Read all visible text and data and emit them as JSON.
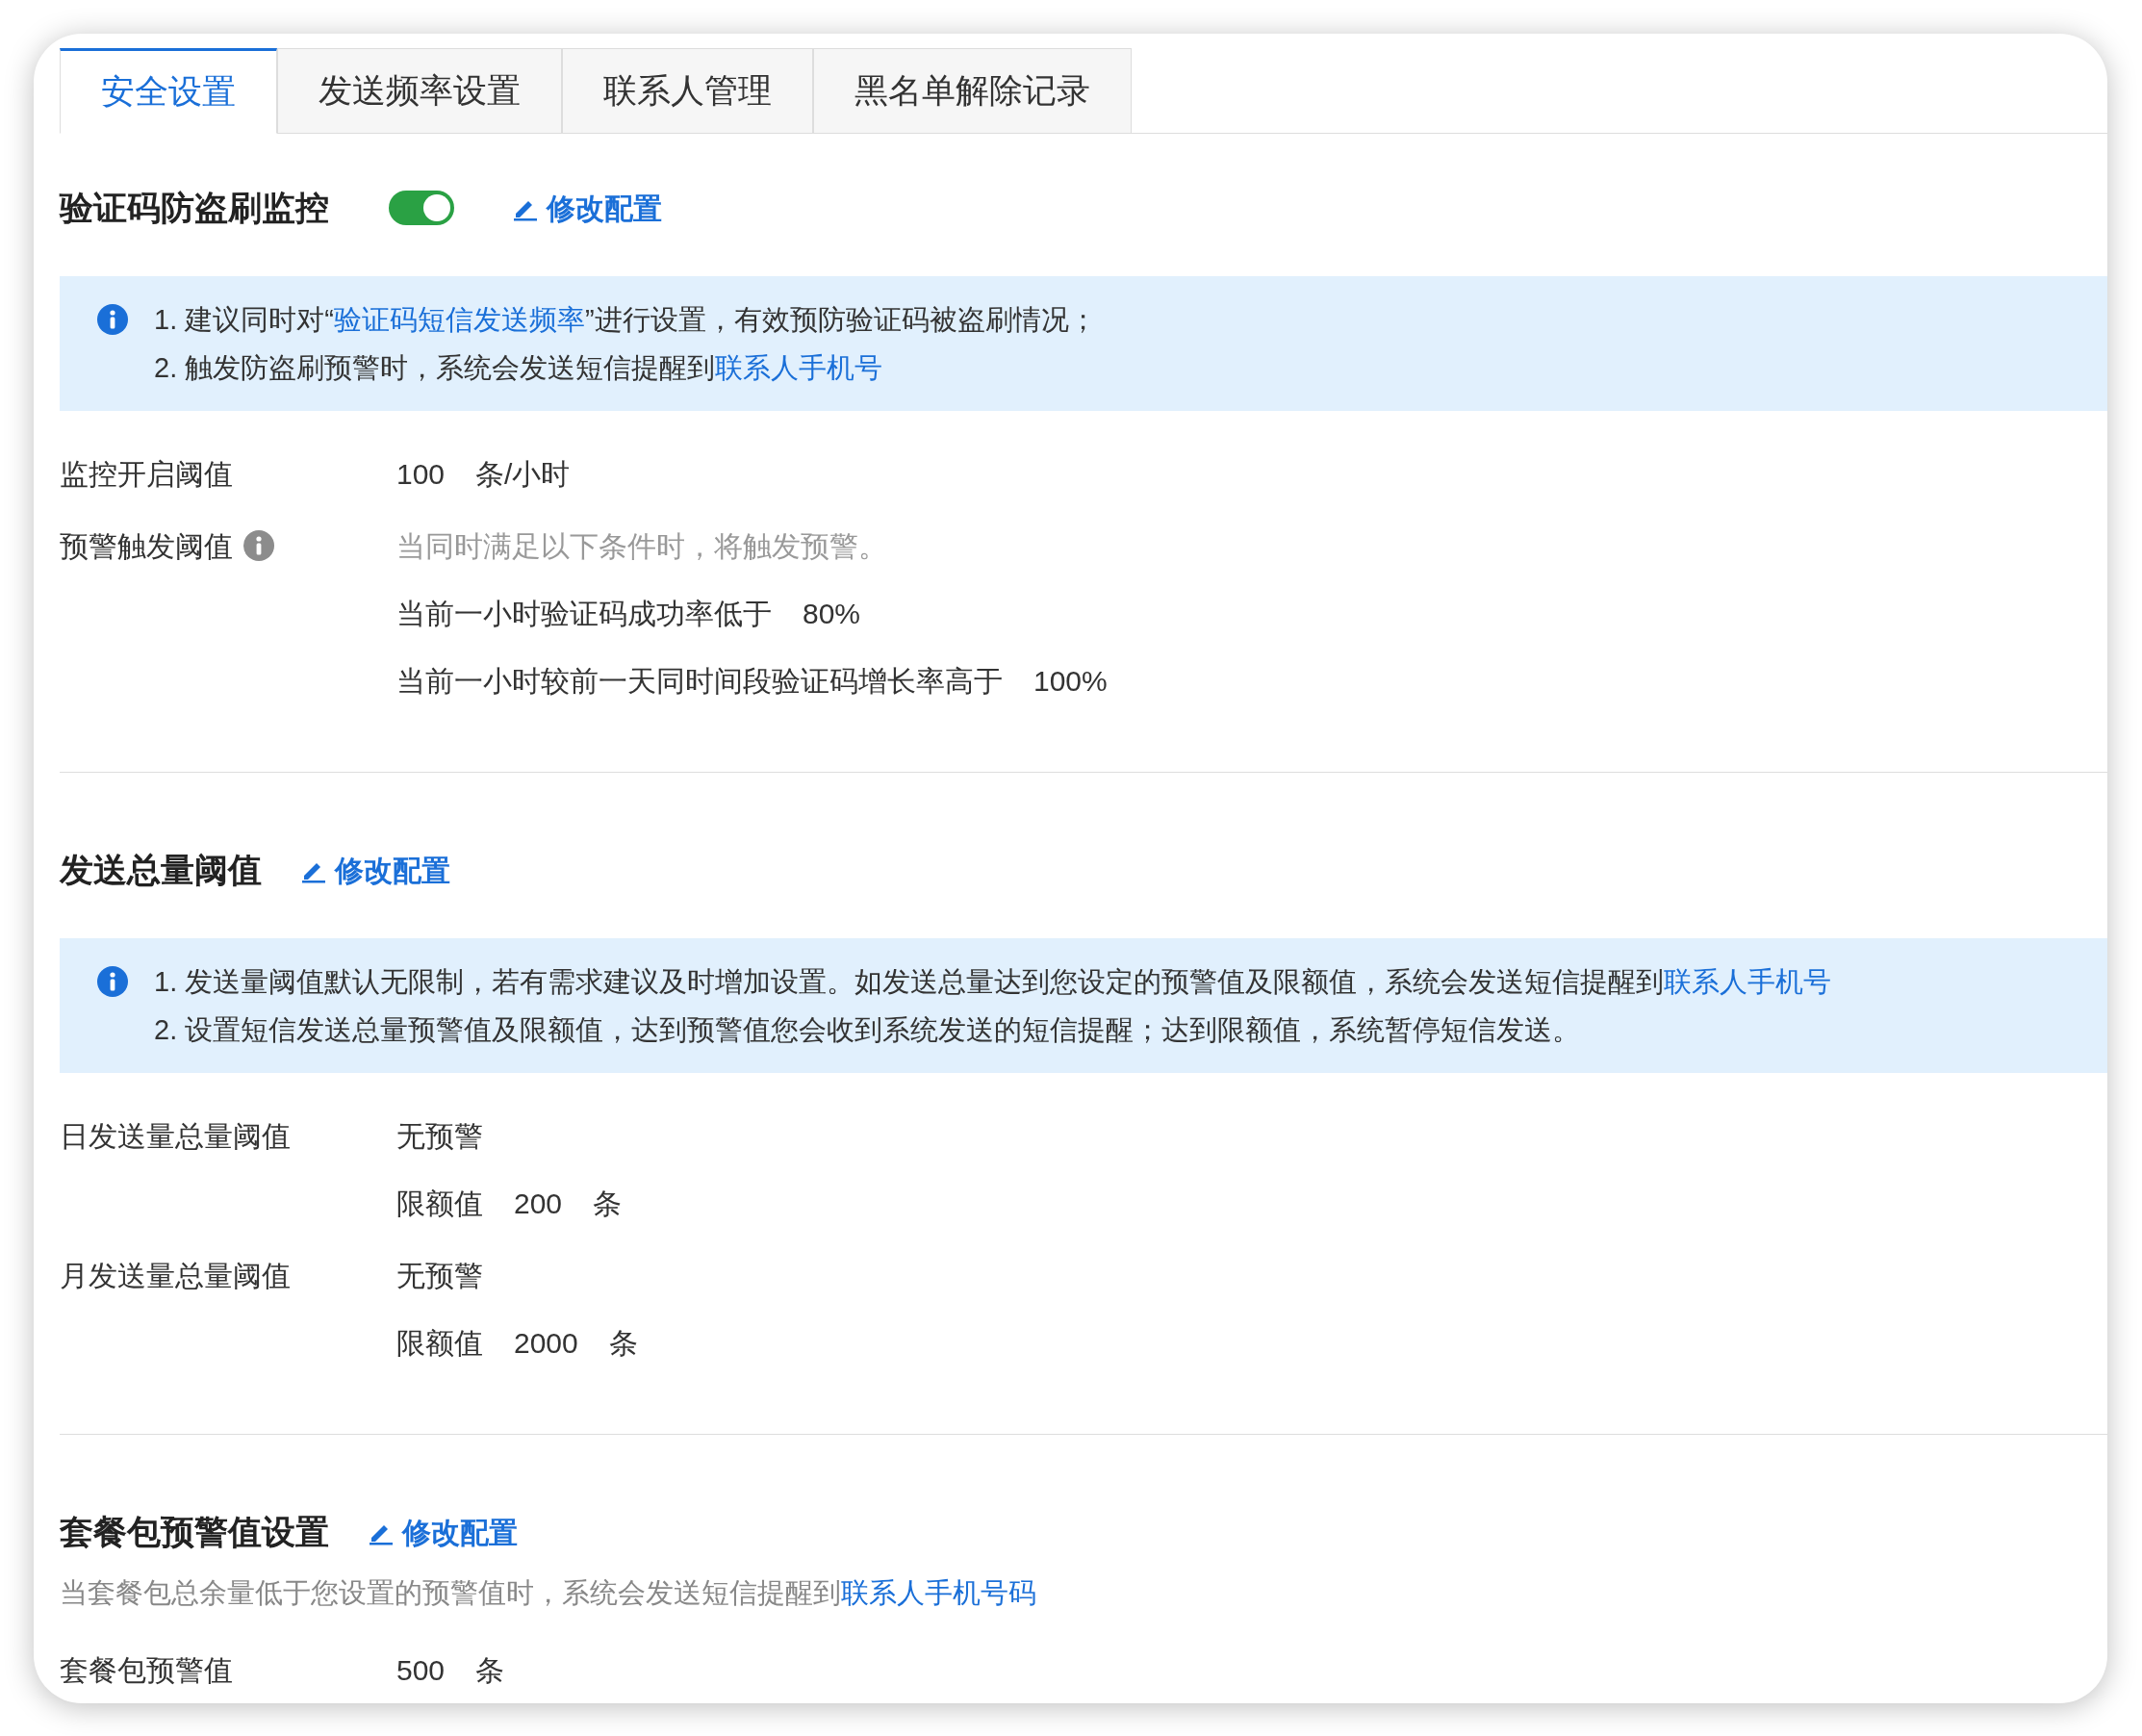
{
  "tabs": [
    {
      "label": "安全设置",
      "selected": true
    },
    {
      "label": "发送频率设置",
      "selected": false
    },
    {
      "label": "联系人管理",
      "selected": false
    },
    {
      "label": "黑名单解除记录",
      "selected": false
    }
  ],
  "sections": [
    {
      "title": "验证码防盗刷监控",
      "toggle": {
        "on": true
      },
      "edit_link": "修改配置",
      "notice": [
        [
          {
            "kind": "text",
            "text": "1. 建议同时对“"
          },
          {
            "kind": "link",
            "text": "验证码短信发送频率"
          },
          {
            "kind": "text",
            "text": "”进行设置，有效预防验证码被盗刷情况；"
          }
        ],
        [
          {
            "kind": "text",
            "text": "2. 触发防盗刷预警时，系统会发送短信提醒到"
          },
          {
            "kind": "link",
            "text": "联系人手机号"
          }
        ]
      ],
      "rows": [
        {
          "label": "监控开启阈值",
          "kind": "plain",
          "lines": [
            {
              "kind": "value",
              "parts": [
                "100",
                "条/小时"
              ]
            }
          ]
        },
        {
          "label": "预警触发阈值",
          "kind": "with_info",
          "lines": [
            {
              "kind": "hint",
              "parts": [
                "当同时满足以下条件时，将触发预警。"
              ]
            },
            {
              "kind": "value",
              "parts": [
                "当前一小时验证码成功率低于",
                "80%"
              ]
            },
            {
              "kind": "value",
              "parts": [
                "当前一小时较前一天同时间段验证码增长率高于",
                "100%"
              ]
            }
          ]
        }
      ]
    },
    {
      "title": "发送总量阈值",
      "edit_link": "修改配置",
      "notice": [
        [
          {
            "kind": "text",
            "text": "1. 发送量阈值默认无限制，若有需求建议及时增加设置。如发送总量达到您设定的预警值及限额值，系统会发送短信提醒到"
          },
          {
            "kind": "link",
            "text": "联系人手机号"
          }
        ],
        [
          {
            "kind": "text",
            "text": "2. 设置短信发送总量预警值及限额值，达到预警值您会收到系统发送的短信提醒；达到限额值，系统暂停短信发送。"
          }
        ]
      ],
      "rows": [
        {
          "label": "日发送量总量阈值",
          "kind": "plain",
          "lines": [
            {
              "kind": "value",
              "parts": [
                "无预警"
              ]
            },
            {
              "kind": "value",
              "parts": [
                "限额值",
                "200",
                "条"
              ]
            }
          ]
        },
        {
          "label": "月发送量总量阈值",
          "kind": "plain",
          "lines": [
            {
              "kind": "value",
              "parts": [
                "无预警"
              ]
            },
            {
              "kind": "value",
              "parts": [
                "限额值",
                "2000",
                "条"
              ]
            }
          ]
        }
      ]
    },
    {
      "title": "套餐包预警值设置",
      "edit_link": "修改配置",
      "description": [
        {
          "kind": "text",
          "text": "当套餐包总余量低于您设置的预警值时，系统会发送短信提醒到"
        },
        {
          "kind": "link",
          "text": "联系人手机号码"
        }
      ],
      "rows": [
        {
          "label": "套餐包预警值",
          "kind": "plain",
          "lines": [
            {
              "kind": "value",
              "parts": [
                "500",
                "条"
              ]
            }
          ]
        }
      ]
    }
  ]
}
